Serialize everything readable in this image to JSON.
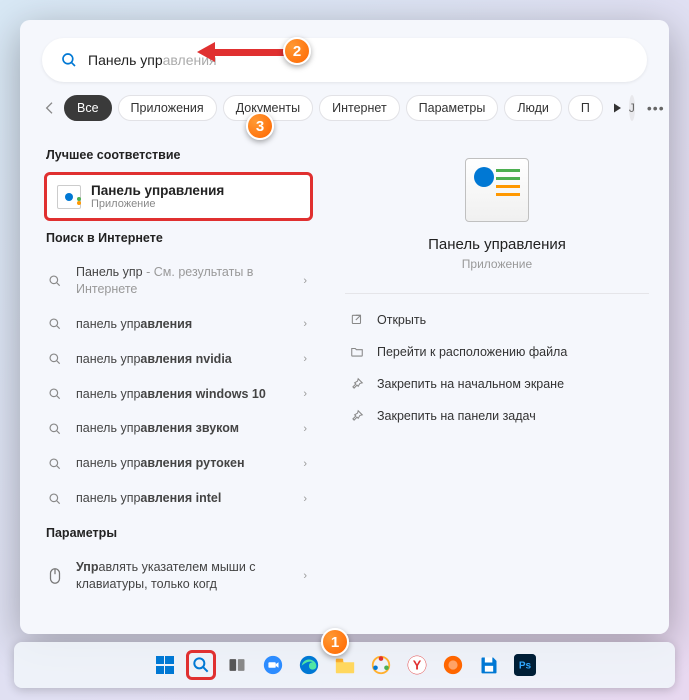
{
  "search": {
    "typed": "Панель упр",
    "ghost": "авления"
  },
  "filters": {
    "items": [
      "Все",
      "Приложения",
      "Документы",
      "Интернет",
      "Параметры",
      "Люди",
      "П"
    ],
    "activeIndex": 0
  },
  "user_initial": "J",
  "left": {
    "best_section": "Лучшее соответствие",
    "best": {
      "title": "Панель управления",
      "subtitle": "Приложение"
    },
    "web_section": "Поиск в Интернете",
    "web": [
      {
        "pre": "Панель упр",
        "dim": " - См. результаты в Интернете",
        "hl": ""
      },
      {
        "pre": "панель упр",
        "hl": "авления"
      },
      {
        "pre": "панель упр",
        "hl": "авления nvidia"
      },
      {
        "pre": "панель упр",
        "hl": "авления windows 10"
      },
      {
        "pre": "панель упр",
        "hl": "авления звуком"
      },
      {
        "pre": "панель упр",
        "hl": "авления рутокен"
      },
      {
        "pre": "панель упр",
        "hl": "авления intel"
      }
    ],
    "settings_section": "Параметры",
    "settings": {
      "pre": "Упр",
      "hl": "авлять",
      "rest": " указателем мыши с клавиатуры, только когд"
    }
  },
  "preview": {
    "title": "Панель управления",
    "subtitle": "Приложение",
    "actions": [
      {
        "icon": "open",
        "label": "Открыть"
      },
      {
        "icon": "folder",
        "label": "Перейти к расположению файла"
      },
      {
        "icon": "pin",
        "label": "Закрепить на начальном экране"
      },
      {
        "icon": "pin",
        "label": "Закрепить на панели задач"
      }
    ]
  },
  "markers": {
    "m1": "1",
    "m2": "2",
    "m3": "3"
  }
}
